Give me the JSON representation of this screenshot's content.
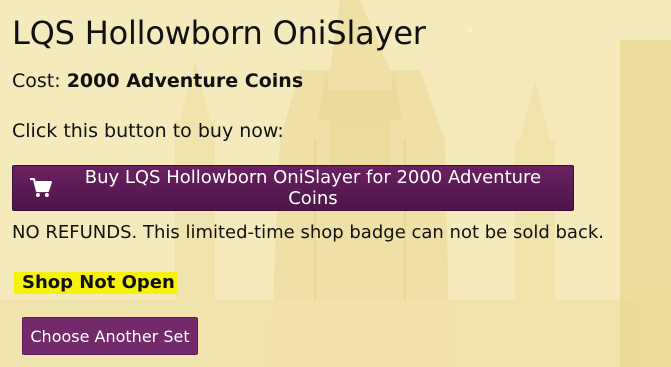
{
  "product": {
    "title": "LQS Hollowborn OniSlayer",
    "cost_label": "Cost:",
    "cost_value": "2000 Adventure Coins"
  },
  "purchase": {
    "instructions": "Click this button to buy now:",
    "buy_button_label": "Buy LQS Hollowborn OniSlayer for 2000 Adventure Coins",
    "buy_button_icon": "shopping-cart-icon",
    "refund_notice": "NO REFUNDS. This limited-time shop badge can not be sold back."
  },
  "shop": {
    "status": "Shop Not Open",
    "status_color": "#f6f20a",
    "another_button_label": "Choose Another Set"
  },
  "theme": {
    "button_color": "#5c1a55",
    "background_color": "#f3e7b4"
  }
}
